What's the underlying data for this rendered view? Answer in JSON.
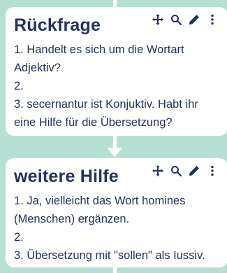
{
  "colors": {
    "background": "#b7e0d4",
    "card": "#ffffff",
    "text": "#23315c",
    "connector": "#ffffff"
  },
  "icons": [
    "move-icon",
    "search-icon",
    "pencil-icon",
    "more-vertical-icon"
  ],
  "cards": [
    {
      "title": "Rückfrage",
      "lines": [
        "1. Handelt es sich um die Wortart",
        "Adjektiv?",
        "2.",
        "3. secernantur ist Konjuktiv. Habt ihr",
        "eine Hilfe für die Übersetzung?"
      ]
    },
    {
      "title": "weitere Hilfe",
      "lines": [
        "1. Ja, vielleicht das Wort homines",
        "(Menschen) ergänzen.",
        "2.",
        "3. Übersetzung mit \"sollen\" als Iussiv."
      ]
    }
  ]
}
